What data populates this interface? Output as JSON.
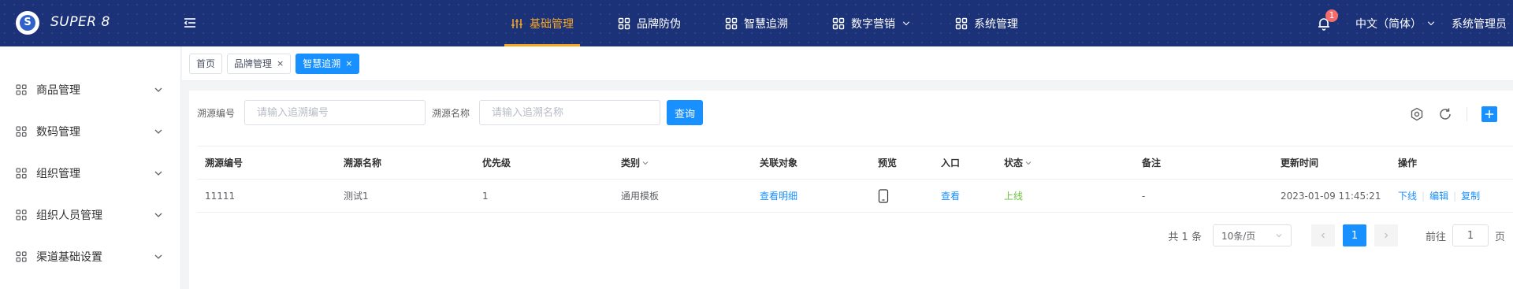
{
  "header": {
    "brand": "SUPER 8",
    "logo_letter": "S",
    "nav": [
      {
        "label": "基础管理",
        "icon": "sliders-icon",
        "active": true
      },
      {
        "label": "品牌防伪",
        "icon": "grid-icon"
      },
      {
        "label": "智慧追溯",
        "icon": "grid-icon"
      },
      {
        "label": "数字营销",
        "icon": "grid-icon",
        "dropdown": true
      },
      {
        "label": "系统管理",
        "icon": "grid-icon"
      }
    ],
    "notification_count": "1",
    "language": "中文（简体）",
    "user": "系统管理员"
  },
  "sidebar": {
    "items": [
      {
        "label": "商品管理"
      },
      {
        "label": "数码管理"
      },
      {
        "label": "组织管理"
      },
      {
        "label": "组织人员管理"
      },
      {
        "label": "渠道基础设置"
      }
    ]
  },
  "tags": {
    "items": [
      {
        "label": "首页"
      },
      {
        "label": "品牌管理",
        "close": "×"
      },
      {
        "label": "智慧追溯",
        "close": "×",
        "active": true
      }
    ]
  },
  "search": {
    "source_code_label": "溯源编号",
    "source_code_placeholder": "请输入追溯编号",
    "source_name_label": "溯源名称",
    "source_name_placeholder": "请输入追溯名称",
    "query_label": "查询"
  },
  "table": {
    "columns": [
      "溯源编号",
      "溯源名称",
      "优先级",
      "类别",
      "关联对象",
      "预览",
      "入口",
      "状态",
      "备注",
      "更新时间",
      "操作"
    ],
    "rows": [
      {
        "code": "11111",
        "name": "测试1",
        "priority": "1",
        "category": "通用模板",
        "related": "查看明细",
        "entry": "查看",
        "status": "上线",
        "remark": "-",
        "updated": "2023-01-09 11:45:21",
        "ops": [
          "下线",
          "编辑",
          "复制"
        ]
      }
    ]
  },
  "pagination": {
    "total": "共 1 条",
    "page_size": "10条/页",
    "current": "1",
    "goto_prefix": "前往",
    "goto_value": "1",
    "goto_suffix": "页"
  },
  "colors": {
    "header_bg": "#1c3278",
    "accent": "#f5a623",
    "primary": "#1890ff",
    "success": "#67c23a"
  }
}
